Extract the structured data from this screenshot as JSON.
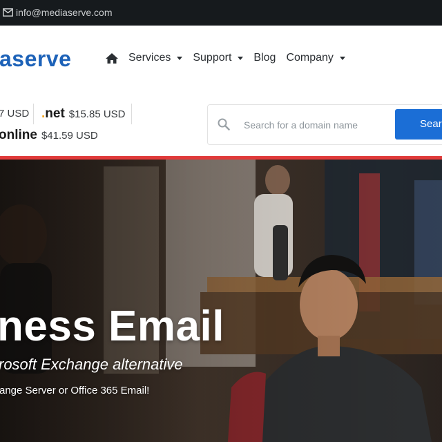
{
  "topbar": {
    "email": "info@mediaserve.com",
    "icon": "envelope-icon"
  },
  "header": {
    "logo_text": "aserve",
    "nav": [
      {
        "label": "Services",
        "has_dropdown": true
      },
      {
        "label": "Support",
        "has_dropdown": true
      },
      {
        "label": "Blog",
        "has_dropdown": false
      },
      {
        "label": "Company",
        "has_dropdown": true
      }
    ],
    "home_icon": "home-icon"
  },
  "domains": {
    "tld1_price": "7 USD",
    "tld2": {
      "dot": ".",
      "ext": "net",
      "price": "$15.85 USD"
    },
    "tld3": {
      "ext": "online",
      "price": "$41.59 USD"
    }
  },
  "search": {
    "placeholder": "Search for a domain name",
    "button_label": "Search"
  },
  "hero": {
    "title": "ness Email",
    "subtitle": "rosoft Exchange alternative",
    "tagline": "ange Server or Office 365 Email!"
  },
  "colors": {
    "topbar_bg": "#161a1d",
    "brand_blue": "#1d62b8",
    "search_button": "#1b6ed6",
    "accent_red": "#e03a3a",
    "net_dot": "#f4a51c"
  }
}
